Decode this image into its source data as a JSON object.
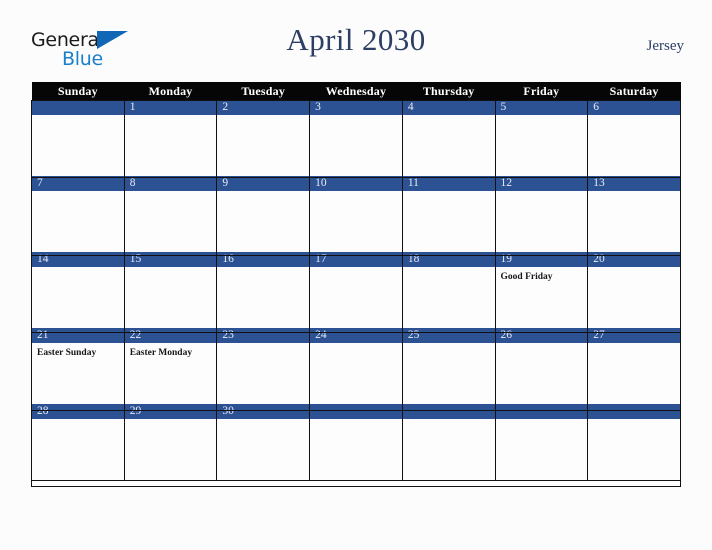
{
  "brand": {
    "line1": "General",
    "line2": "Blue",
    "triangle_color": "#1166b5",
    "text_color": "#1b1b1b",
    "blue_text_color": "#1a7ec8"
  },
  "header": {
    "title": "April 2030",
    "region": "Jersey",
    "title_color": "#2c3e63"
  },
  "theme": {
    "page_background": "#fcfcfd",
    "weekday_header_background": "#060606",
    "weekday_header_text": "#ffffff",
    "date_band_background": "#2d5293",
    "date_band_text": "#e8ecf5",
    "cell_background": "#fdfdfd",
    "grid_line": "#111111",
    "event_text": "#15161a"
  },
  "weekdays": [
    "Sunday",
    "Monday",
    "Tuesday",
    "Wednesday",
    "Thursday",
    "Friday",
    "Saturday"
  ],
  "weeks": [
    [
      {
        "date": "",
        "events": []
      },
      {
        "date": "1",
        "events": []
      },
      {
        "date": "2",
        "events": []
      },
      {
        "date": "3",
        "events": []
      },
      {
        "date": "4",
        "events": []
      },
      {
        "date": "5",
        "events": []
      },
      {
        "date": "6",
        "events": []
      }
    ],
    [
      {
        "date": "7",
        "events": []
      },
      {
        "date": "8",
        "events": []
      },
      {
        "date": "9",
        "events": []
      },
      {
        "date": "10",
        "events": []
      },
      {
        "date": "11",
        "events": []
      },
      {
        "date": "12",
        "events": []
      },
      {
        "date": "13",
        "events": []
      }
    ],
    [
      {
        "date": "14",
        "events": []
      },
      {
        "date": "15",
        "events": []
      },
      {
        "date": "16",
        "events": []
      },
      {
        "date": "17",
        "events": []
      },
      {
        "date": "18",
        "events": []
      },
      {
        "date": "19",
        "events": [
          "Good Friday"
        ]
      },
      {
        "date": "20",
        "events": []
      }
    ],
    [
      {
        "date": "21",
        "events": [
          "Easter Sunday"
        ]
      },
      {
        "date": "22",
        "events": [
          "Easter Monday"
        ]
      },
      {
        "date": "23",
        "events": []
      },
      {
        "date": "24",
        "events": []
      },
      {
        "date": "25",
        "events": []
      },
      {
        "date": "26",
        "events": []
      },
      {
        "date": "27",
        "events": []
      }
    ],
    [
      {
        "date": "28",
        "events": []
      },
      {
        "date": "29",
        "events": []
      },
      {
        "date": "30",
        "events": []
      },
      {
        "date": "",
        "events": []
      },
      {
        "date": "",
        "events": []
      },
      {
        "date": "",
        "events": []
      },
      {
        "date": "",
        "events": []
      }
    ]
  ]
}
